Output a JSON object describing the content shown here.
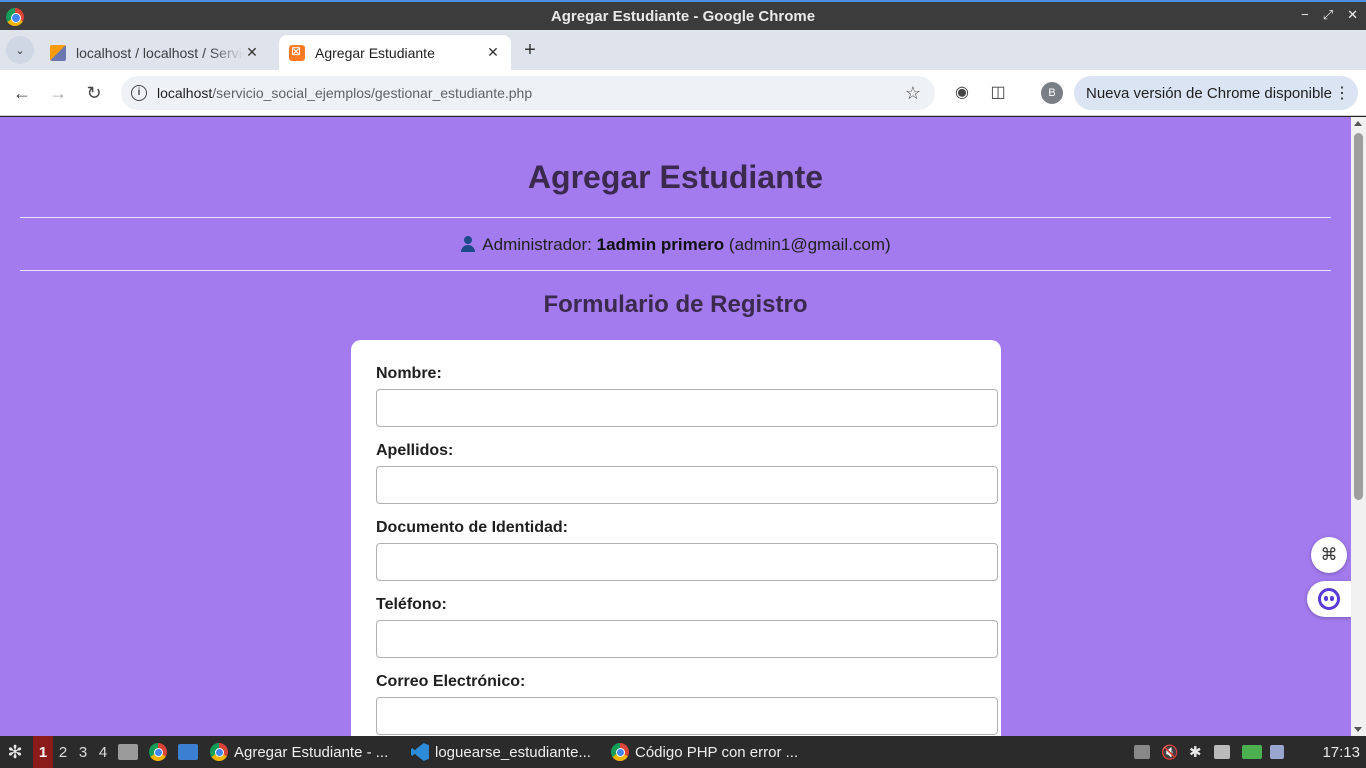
{
  "window": {
    "title": "Agregar Estudiante - Google Chrome"
  },
  "tabs": [
    {
      "label": "localhost / localhost / Servidor",
      "active": false
    },
    {
      "label": "Agregar Estudiante",
      "active": true
    }
  ],
  "address_bar": {
    "host": "localhost",
    "path": "/servicio_social_ejemplos/gestionar_estudiante.php"
  },
  "profile": {
    "initial": "B"
  },
  "update_chip": {
    "label": "Nueva versión de Chrome disponible"
  },
  "page": {
    "title": "Agregar Estudiante",
    "admin": {
      "prefix": "Administrador:",
      "name": "1admin primero",
      "email": "(admin1@gmail.com)"
    },
    "form_title": "Formulario de Registro",
    "fields": [
      {
        "label": "Nombre:",
        "value": ""
      },
      {
        "label": "Apellidos:",
        "value": ""
      },
      {
        "label": "Documento de Identidad:",
        "value": ""
      },
      {
        "label": "Teléfono:",
        "value": ""
      },
      {
        "label": "Correo Electrónico:",
        "value": ""
      }
    ]
  },
  "taskbar": {
    "workspaces": [
      "1",
      "2",
      "3",
      "4"
    ],
    "tasks": [
      {
        "label": "Agregar Estudiante - ...",
        "icon": "chrome-icon"
      },
      {
        "label": "loguearse_estudiante...",
        "icon": "vscode-icon"
      },
      {
        "label": "Código PHP con error ...",
        "icon": "chrome-icon"
      }
    ],
    "clock": "17:13"
  },
  "colors": {
    "page_background": "#a37bef",
    "heading": "#3b2a4d",
    "form_card": "#ffffff"
  }
}
